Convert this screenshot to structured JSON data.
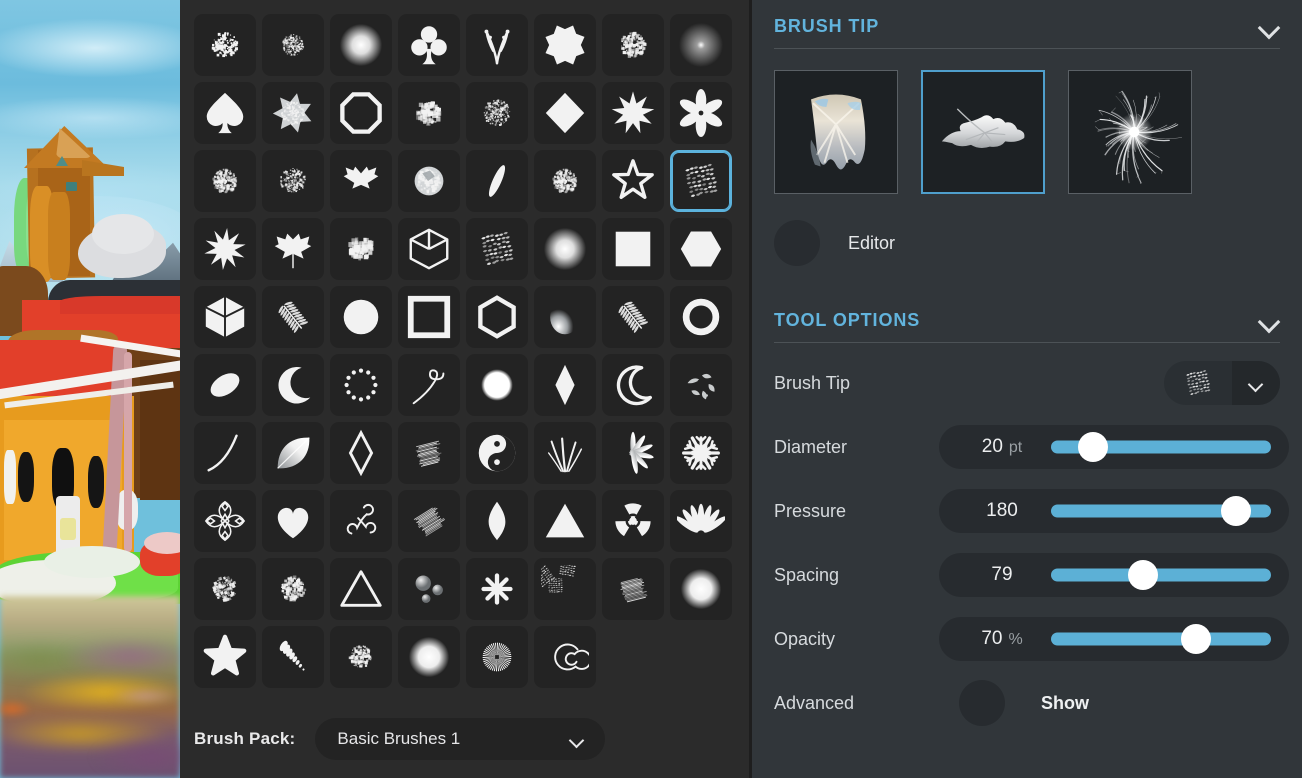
{
  "canvas": {
    "name": "painting-canvas",
    "description": "Digital painting of an orange house with red and brown walls, green foliage, blue sky and a blurred reflective water foreground"
  },
  "brush_panel": {
    "brush_pack": {
      "label": "Brush Pack:",
      "value": "Basic Brushes 1",
      "chevron_icon": "chevron-down-icon"
    },
    "selected_index": 23,
    "columns": 8,
    "brushes": [
      {
        "i": 0,
        "name": "speckle-splatter-brush",
        "icon": "splatter"
      },
      {
        "i": 1,
        "name": "soft-noise-brush",
        "icon": "noise-soft"
      },
      {
        "i": 2,
        "name": "soft-round-glow-brush",
        "icon": "glow"
      },
      {
        "i": 3,
        "name": "club-brush",
        "icon": "club"
      },
      {
        "i": 4,
        "name": "sprig-brush",
        "icon": "sprig"
      },
      {
        "i": 5,
        "name": "eight-point-burst-brush",
        "icon": "burst8"
      },
      {
        "i": 6,
        "name": "rough-cloud-brush",
        "icon": "cloud-rough"
      },
      {
        "i": 7,
        "name": "soft-fade-dot-brush",
        "icon": "glow-dim"
      },
      {
        "i": 8,
        "name": "spade-brush",
        "icon": "spade"
      },
      {
        "i": 9,
        "name": "crystal-flake-brush",
        "icon": "flake-grey"
      },
      {
        "i": 10,
        "name": "octagon-outline-brush",
        "icon": "octagon-outline"
      },
      {
        "i": 11,
        "name": "grunge-blob-brush",
        "icon": "grunge"
      },
      {
        "i": 12,
        "name": "fine-spatter-brush",
        "icon": "spatter-fine"
      },
      {
        "i": 13,
        "name": "diamond-brush",
        "icon": "diamond"
      },
      {
        "i": 14,
        "name": "nine-point-star-brush",
        "icon": "star9"
      },
      {
        "i": 15,
        "name": "flower-brush",
        "icon": "flower"
      },
      {
        "i": 16,
        "name": "chalk-round-brush",
        "icon": "chalk-round"
      },
      {
        "i": 17,
        "name": "dotted-round-brush",
        "icon": "dots-round"
      },
      {
        "i": 18,
        "name": "maple-leaf-brush",
        "icon": "maple"
      },
      {
        "i": 19,
        "name": "texture-ball-brush",
        "icon": "texture-ball"
      },
      {
        "i": 20,
        "name": "ellipse-blade-brush",
        "icon": "blade"
      },
      {
        "i": 21,
        "name": "chalk-round-brush-2",
        "icon": "chalk-round"
      },
      {
        "i": 22,
        "name": "star-outline-brush",
        "icon": "star-outline"
      },
      {
        "i": 23,
        "name": "scribble-texture-brush",
        "icon": "scribble"
      },
      {
        "i": 24,
        "name": "spiky-starburst-brush",
        "icon": "spiky"
      },
      {
        "i": 25,
        "name": "maple-leaf-solid-brush",
        "icon": "maple-solid"
      },
      {
        "i": 26,
        "name": "splotch-brush",
        "icon": "splotch"
      },
      {
        "i": 27,
        "name": "cube-outline-brush",
        "icon": "cube-outline"
      },
      {
        "i": 28,
        "name": "scribble-texture-brush-2",
        "icon": "scribble"
      },
      {
        "i": 29,
        "name": "soft-round-glow-brush-2",
        "icon": "glow"
      },
      {
        "i": 30,
        "name": "square-brush",
        "icon": "square-solid"
      },
      {
        "i": 31,
        "name": "hexagon-brush",
        "icon": "hexagon-solid"
      },
      {
        "i": 32,
        "name": "cube-solid-brush",
        "icon": "cube-solid"
      },
      {
        "i": 33,
        "name": "fern-brush",
        "icon": "fern"
      },
      {
        "i": 34,
        "name": "circle-brush",
        "icon": "circle-solid"
      },
      {
        "i": 35,
        "name": "square-outline-brush",
        "icon": "square-outline"
      },
      {
        "i": 36,
        "name": "hexagon-outline-brush",
        "icon": "hexagon-outline"
      },
      {
        "i": 37,
        "name": "gradient-sphere-brush",
        "icon": "sphere"
      },
      {
        "i": 38,
        "name": "fern-brush-2",
        "icon": "fern"
      },
      {
        "i": 39,
        "name": "ring-brush",
        "icon": "ring"
      },
      {
        "i": 40,
        "name": "ellipse-tilt-brush",
        "icon": "ellipse-tilt"
      },
      {
        "i": 41,
        "name": "crescent-moon-brush",
        "icon": "moon"
      },
      {
        "i": 42,
        "name": "dotted-ring-brush",
        "icon": "dotted-ring"
      },
      {
        "i": 43,
        "name": "swirl-tail-brush",
        "icon": "swirl-tail"
      },
      {
        "i": 44,
        "name": "soft-circle-brush",
        "icon": "circle-soft"
      },
      {
        "i": 45,
        "name": "narrow-diamond-brush",
        "icon": "diamond-narrow"
      },
      {
        "i": 46,
        "name": "crescent-outline-brush",
        "icon": "moon-outline"
      },
      {
        "i": 47,
        "name": "scatter-texture-brush",
        "icon": "scatter"
      },
      {
        "i": 48,
        "name": "thin-curve-brush",
        "icon": "curve"
      },
      {
        "i": 49,
        "name": "feather-leaf-brush",
        "icon": "feather-leaf"
      },
      {
        "i": 50,
        "name": "rhombus-outline-brush",
        "icon": "rhombus-outline"
      },
      {
        "i": 51,
        "name": "rough-stroke-brush",
        "icon": "rough-stroke"
      },
      {
        "i": 52,
        "name": "yin-yang-brush",
        "icon": "yinyang"
      },
      {
        "i": 53,
        "name": "grass-brush",
        "icon": "grass"
      },
      {
        "i": 54,
        "name": "wispy-burst-brush",
        "icon": "wispy"
      },
      {
        "i": 55,
        "name": "snowflake-brush",
        "icon": "snowflake"
      },
      {
        "i": 56,
        "name": "ornament-brush",
        "icon": "ornament"
      },
      {
        "i": 57,
        "name": "heart-brush",
        "icon": "heart"
      },
      {
        "i": 58,
        "name": "flourish-brush",
        "icon": "flourish"
      },
      {
        "i": 59,
        "name": "dry-brush-stroke",
        "icon": "dry-stroke"
      },
      {
        "i": 60,
        "name": "leaf-drop-brush",
        "icon": "leaf-drop"
      },
      {
        "i": 61,
        "name": "triangle-brush",
        "icon": "triangle-solid"
      },
      {
        "i": 62,
        "name": "radiation-brush",
        "icon": "radiation"
      },
      {
        "i": 63,
        "name": "palm-fan-brush",
        "icon": "palm-fan"
      },
      {
        "i": 64,
        "name": "charcoal-smudge-brush",
        "icon": "charcoal"
      },
      {
        "i": 65,
        "name": "confetti-brush",
        "icon": "confetti"
      },
      {
        "i": 66,
        "name": "triangle-outline-brush",
        "icon": "triangle-outline"
      },
      {
        "i": 67,
        "name": "bubbles-brush",
        "icon": "bubbles"
      },
      {
        "i": 68,
        "name": "asterisk-brush",
        "icon": "asterisk"
      },
      {
        "i": 69,
        "name": "torn-paper-brush",
        "icon": "torn"
      },
      {
        "i": 70,
        "name": "hatch-texture-brush",
        "icon": "hatch"
      },
      {
        "i": 71,
        "name": "soft-blur-dot-brush",
        "icon": "glow-big"
      },
      {
        "i": 72,
        "name": "five-point-star-brush",
        "icon": "star5"
      },
      {
        "i": 73,
        "name": "spiral-shell-brush",
        "icon": "shell"
      },
      {
        "i": 74,
        "name": "dust-cloud-brush",
        "icon": "dust"
      },
      {
        "i": 75,
        "name": "soft-blur-dot-brush-2",
        "icon": "glow-big"
      },
      {
        "i": 76,
        "name": "sunburst-rays-brush",
        "icon": "rays"
      },
      {
        "i": 77,
        "name": "spiral-brush",
        "icon": "spiral"
      }
    ]
  },
  "brush_tip_section": {
    "title": "BRUSH TIP",
    "collapse_icon": "chevron-down-icon",
    "thumbnails": [
      {
        "name": "brush-tip-thumb-shell",
        "icon": "shell-photo",
        "selected": false
      },
      {
        "name": "brush-tip-thumb-leaf",
        "icon": "leaf-photo",
        "selected": true
      },
      {
        "name": "brush-tip-thumb-spark",
        "icon": "spark-photo",
        "selected": false
      }
    ],
    "editor": {
      "button_name": "editor-toggle",
      "label": "Editor"
    }
  },
  "tool_options": {
    "title": "TOOL OPTIONS",
    "collapse_icon": "chevron-down-icon",
    "brush_tip": {
      "label": "Brush Tip",
      "icon": "scribble",
      "chevron_icon": "chevron-down-icon"
    },
    "sliders": [
      {
        "name": "diameter-slider",
        "label": "Diameter",
        "value": "20",
        "unit": "pt",
        "percent": 19
      },
      {
        "name": "pressure-slider",
        "label": "Pressure",
        "value": "180",
        "unit": "",
        "percent": 84
      },
      {
        "name": "spacing-slider",
        "label": "Spacing",
        "value": "79",
        "unit": "",
        "percent": 42
      },
      {
        "name": "opacity-slider",
        "label": "Opacity",
        "value": "70",
        "unit": "%",
        "percent": 66
      }
    ],
    "advanced": {
      "label": "Advanced",
      "toggle_name": "advanced-toggle",
      "show_label": "Show"
    }
  },
  "colors": {
    "accent": "#62b4dd",
    "slider_track": "#5cb0d6",
    "selection_border": "#5cb3dd",
    "panel_bg": "#31363a",
    "grid_bg": "#2b2b2b",
    "cell_bg": "#232323"
  }
}
